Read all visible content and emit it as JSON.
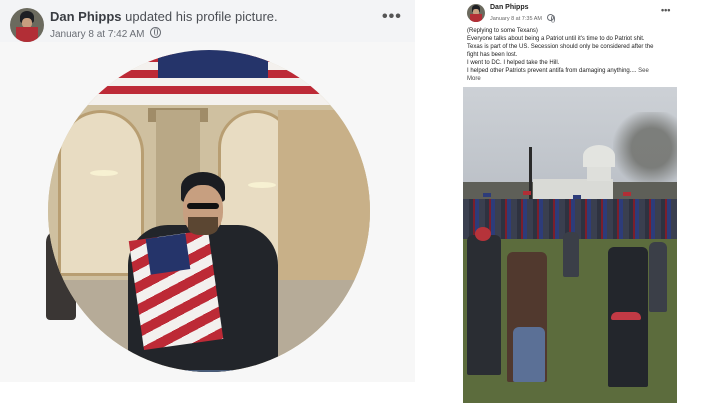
{
  "left_post": {
    "author": "Dan Phipps",
    "action": " updated his profile picture.",
    "timestamp": "January 8 at 7:42 AM",
    "more_label": "•••",
    "icons": {
      "audience": "globe-icon",
      "more": "more-options-icon"
    }
  },
  "right_post": {
    "author": "Dan Phipps",
    "timestamp": "January 8 at 7:35 AM",
    "more_label": "•••",
    "lines": [
      "(Replying to some Texans)",
      "Everyone talks about being a Patriot until it's time to do Patriot shit.",
      "Texas is part of the US. Secession should only be considered after the",
      "fight has been lost.",
      "I went to DC. I helped take the Hill.",
      "I helped other Patriots prevent antifa from damaging anything...."
    ],
    "see_more": "See",
    "see_more_2": "More",
    "icons": {
      "more": "more-options-icon"
    }
  },
  "colors": {
    "header_bg": "#f3f4f6",
    "author_text": "#393c42",
    "secondary_text": "#6a6e75",
    "flag_red": "#bd2a36",
    "flag_blue": "#25346a"
  }
}
